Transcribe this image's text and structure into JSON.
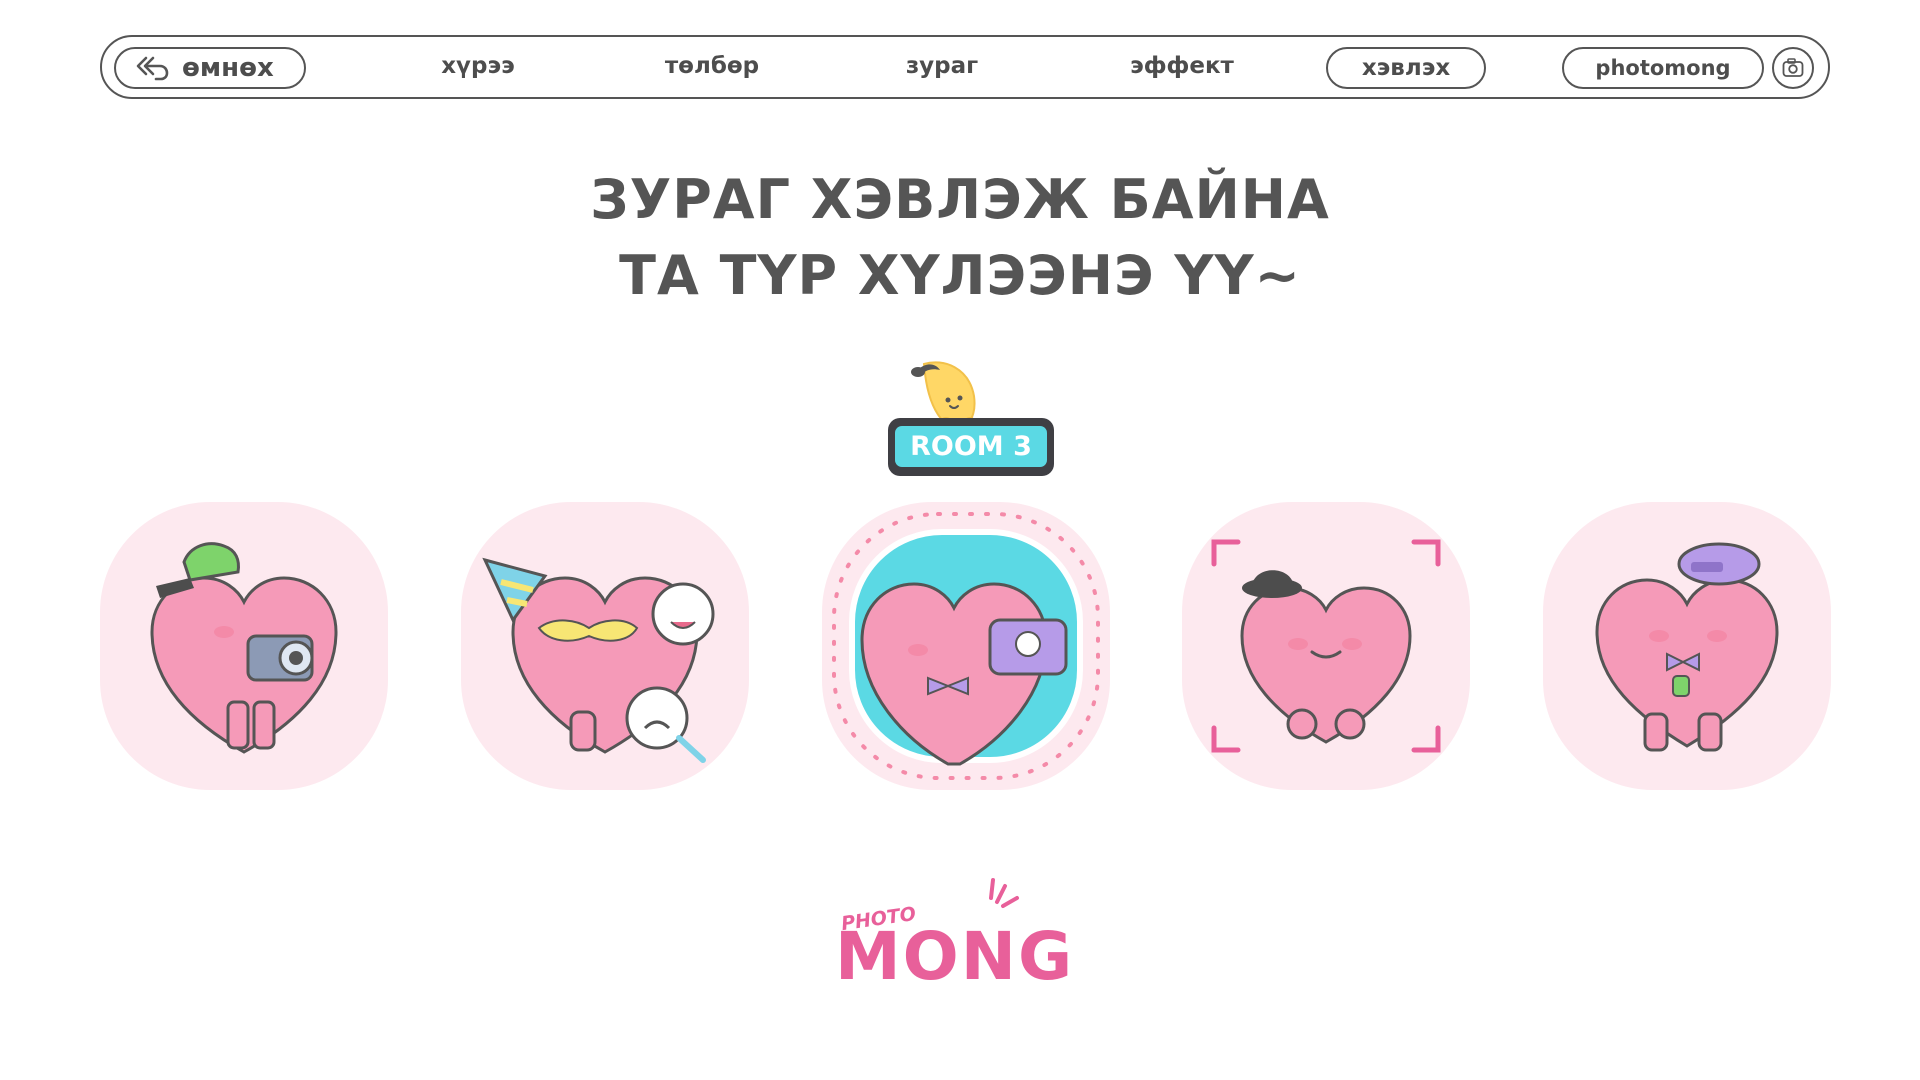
{
  "nav": {
    "back_label": "өмнөх",
    "items": [
      "хүрээ",
      "төлбөр",
      "зураг",
      "эффект"
    ],
    "active_label": "хэвлэх",
    "brand_label": "photomong",
    "back_icon": "back-arrow-icon",
    "camera_icon": "camera-icon"
  },
  "title": {
    "line1": "ЗУРАГ ХЭВЛЭЖ БАЙНА",
    "line2": "ТА ТҮР ХҮЛЭЭНЭ ҮҮ~"
  },
  "room": {
    "label": "ROOM 3"
  },
  "characters": [
    "heart-with-camera-icon",
    "heart-with-party-hat-icon",
    "heart-selfie-icon",
    "heart-with-fedora-icon",
    "heart-with-beret-icon"
  ],
  "logo": {
    "top": "PHOTO",
    "main": "MONG"
  },
  "colors": {
    "text": "#555555",
    "pink": "#e8609a",
    "card_bg": "#fde9ef",
    "room_cyan": "#5bd9e4"
  }
}
